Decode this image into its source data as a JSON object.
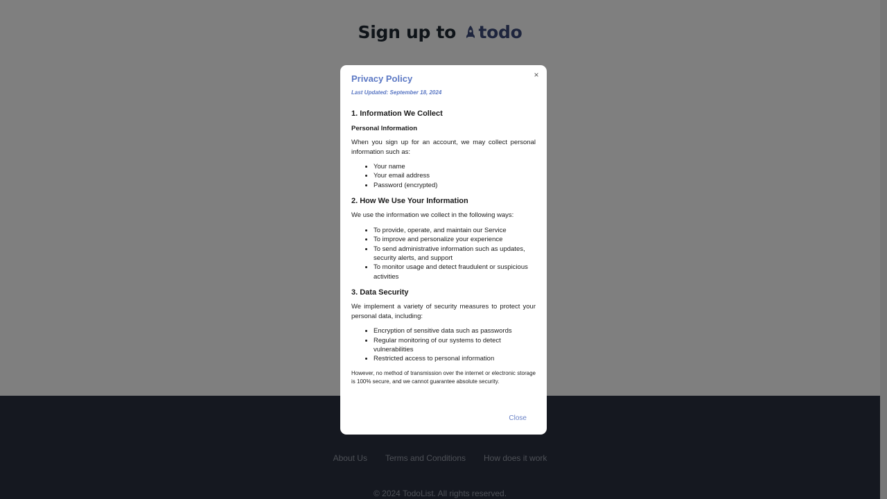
{
  "page": {
    "title_prefix": "Sign up to",
    "brand": "todo"
  },
  "footer": {
    "links": [
      "About Us",
      "Terms and Conditions",
      "How does it work"
    ],
    "copyright": "© 2024 TodoList. All rights reserved."
  },
  "modal": {
    "close_x": "×",
    "title": "Privacy Policy",
    "last_updated": "Last Updated: September 18, 2024",
    "sections": [
      {
        "heading": "1. Information We Collect",
        "subheading": "Personal Information",
        "text": "When you sign up for an account, we may collect personal information such as:",
        "items": [
          "Your name",
          "Your email address",
          "Password (encrypted)"
        ]
      },
      {
        "heading": "2. How We Use Your Information",
        "text": "We use the information we collect in the following ways:",
        "items": [
          "To provide, operate, and maintain our Service",
          "To improve and personalize your experience",
          "To send administrative information such as updates, security alerts, and support",
          "To monitor usage and detect fraudulent or suspicious activities"
        ]
      },
      {
        "heading": "3. Data Security",
        "text": "We implement a variety of security measures to protect your personal data, including:",
        "items": [
          "Encryption of sensitive data such as passwords",
          "Regular monitoring of our systems to detect vulnerabilities",
          "Restricted access to personal information"
        ],
        "note": "However, no method of transmission over the internet or electronic storage is 100% secure, and we cannot guarantee absolute security."
      }
    ],
    "close_label": "Close"
  },
  "colors": {
    "accent": "#5b78c4",
    "brand": "#3c4a7a",
    "footer_bg": "#2b3040",
    "overlay": "rgba(0,0,0,0.5)"
  }
}
